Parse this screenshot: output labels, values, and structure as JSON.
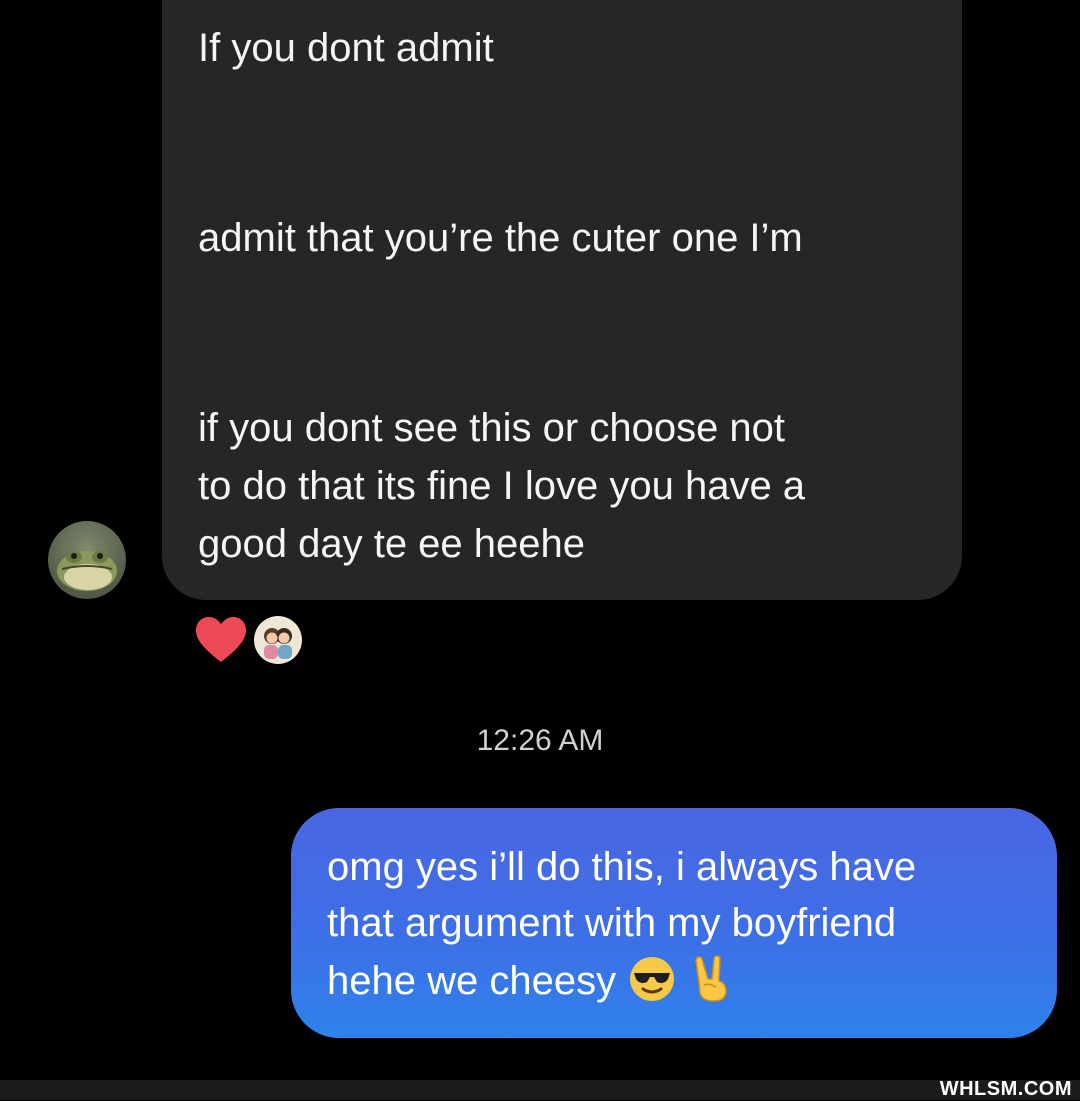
{
  "thread": {
    "incoming_message": {
      "lines": [
        "If you dont admit",
        "admit that you’re the cuter one I’m",
        "if you dont see this or choose not",
        "to do that its fine I love you have a",
        "good day te ee heehe"
      ],
      "reaction_icon": "heart-icon",
      "reaction_color": "#ed4956"
    },
    "timestamp": "12:26 AM",
    "outgoing_message": {
      "lines": [
        "omg yes i’ll do this, i always have",
        "that argument with my boyfriend",
        "hehe we cheesy"
      ],
      "emojis": [
        "sunglasses-emoji",
        "victory-hand-emoji"
      ]
    }
  },
  "watermark": "WHLSM.COM",
  "colors": {
    "background": "#000000",
    "incoming_bubble": "#262626",
    "outgoing_bubble_top": "#4a66e2",
    "outgoing_bubble_bottom": "#2f82ea"
  }
}
